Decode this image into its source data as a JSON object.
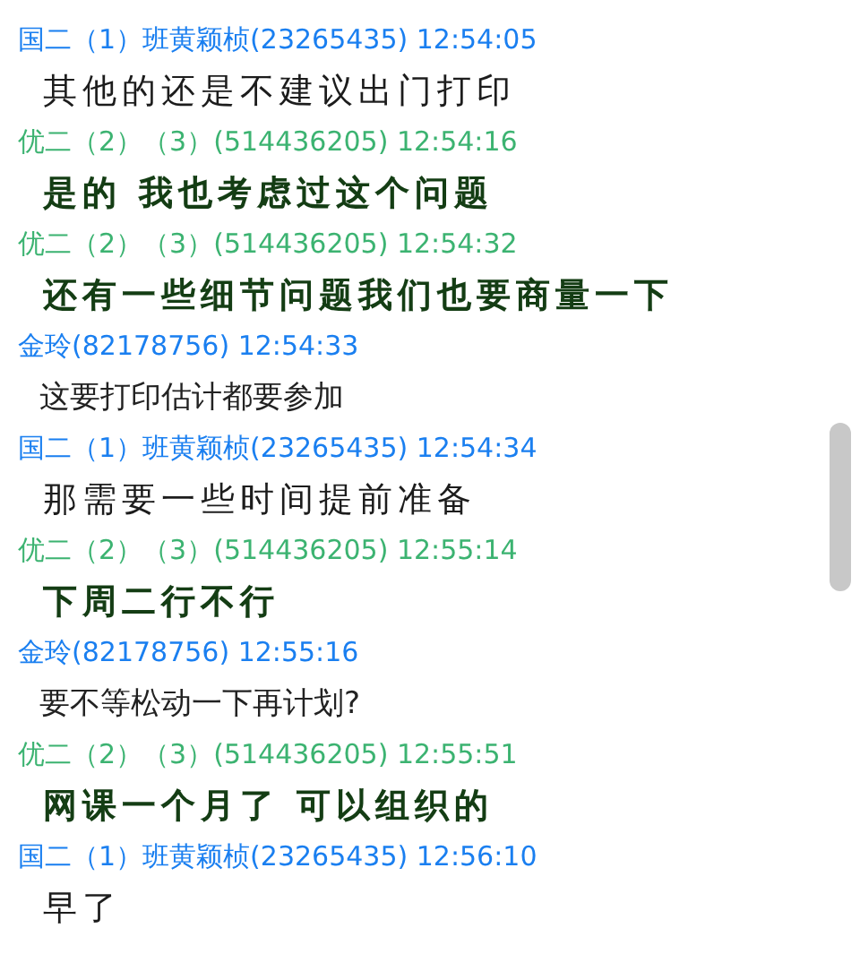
{
  "messages": [
    {
      "sender": "国二（1）班黄颖桢(23265435) 12:54:05",
      "color": "#1a7ff0",
      "text": "其他的还是不建议出门打印",
      "kind": "brush"
    },
    {
      "sender": "优二（2）（3）(514436205) 12:54:16",
      "color": "#3cb371",
      "text": "是的 我也考虑过这个问题",
      "kind": "brush-bold"
    },
    {
      "sender": "优二（2）（3）(514436205) 12:54:32",
      "color": "#3cb371",
      "text": "还有一些细节问题我们也要商量一下",
      "kind": "brush-bold"
    },
    {
      "sender": "金玲(82178756) 12:54:33",
      "color": "#1a7ff0",
      "text": "这要打印估计都要参加",
      "kind": "plain"
    },
    {
      "sender": "国二（1）班黄颖桢(23265435) 12:54:34",
      "color": "#1a7ff0",
      "text": "那需要一些时间提前准备",
      "kind": "brush"
    },
    {
      "sender": "优二（2）（3）(514436205) 12:55:14",
      "color": "#3cb371",
      "text": "下周二行不行",
      "kind": "brush-bold"
    },
    {
      "sender": "金玲(82178756) 12:55:16",
      "color": "#1a7ff0",
      "text": "要不等松动一下再计划?",
      "kind": "plain"
    },
    {
      "sender": "优二（2）（3）(514436205) 12:55:51",
      "color": "#3cb371",
      "text": "网课一个月了 可以组织的",
      "kind": "brush-bold"
    },
    {
      "sender": "国二（1）班黄颖桢(23265435) 12:56:10",
      "color": "#1a7ff0",
      "text": "早了",
      "kind": "brush"
    }
  ]
}
